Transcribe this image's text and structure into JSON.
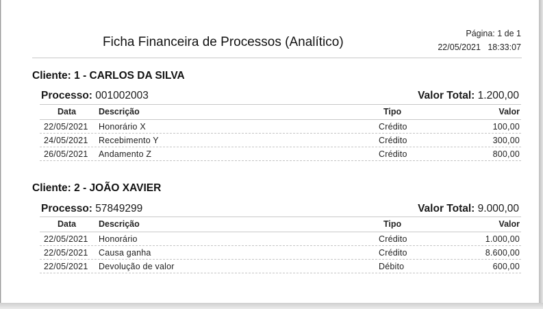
{
  "report": {
    "title": "Ficha Financeira de Processos (Analítico)",
    "page_label": "Página: 1 de 1",
    "date_time": "22/05/2021   18:33:07"
  },
  "columns": {
    "date": "Data",
    "description": "Descrição",
    "type": "Tipo",
    "value": "Valor"
  },
  "labels": {
    "process": "Processo:",
    "total": "Valor Total:"
  },
  "clients": [
    {
      "title": "Cliente: 1 - CARLOS DA SILVA",
      "process_number": "001002003",
      "total_value": "1.200,00",
      "rows": [
        {
          "date": "22/05/2021",
          "description": "Honorário X",
          "type": "Crédito",
          "value": "100,00"
        },
        {
          "date": "24/05/2021",
          "description": "Recebimento Y",
          "type": "Crédito",
          "value": "300,00"
        },
        {
          "date": "26/05/2021",
          "description": "Andamento Z",
          "type": "Crédito",
          "value": "800,00"
        }
      ]
    },
    {
      "title": "Cliente: 2 - JOÃO XAVIER",
      "process_number": "57849299",
      "total_value": "9.000,00",
      "rows": [
        {
          "date": "22/05/2021",
          "description": "Honorário",
          "type": "Crédito",
          "value": "1.000,00"
        },
        {
          "date": "22/05/2021",
          "description": "Causa ganha",
          "type": "Crédito",
          "value": "8.600,00"
        },
        {
          "date": "22/05/2021",
          "description": "Devolução de valor",
          "type": "Débito",
          "value": "600,00"
        }
      ]
    }
  ]
}
